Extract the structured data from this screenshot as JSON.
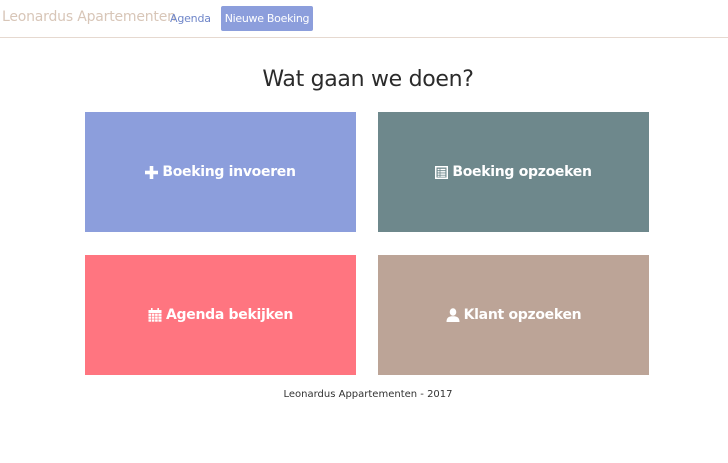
{
  "navbar": {
    "brand": "Leonardus Apartementen",
    "links": [
      {
        "label": "Agenda"
      },
      {
        "label": "Nieuwe Boeking",
        "active": true
      }
    ]
  },
  "main": {
    "title": "Wat gaan we doen?",
    "tiles": [
      {
        "label": "Boeking invoeren",
        "icon": "plus-icon",
        "color": "#8c9edc"
      },
      {
        "label": "Boeking opzoeken",
        "icon": "list-icon",
        "color": "#6e888c"
      },
      {
        "label": "Agenda bekijken",
        "icon": "calendar-icon",
        "color": "#ff7580"
      },
      {
        "label": "Klant opzoeken",
        "icon": "user-icon",
        "color": "#bca497"
      }
    ]
  },
  "footer": {
    "text": "Leonardus Appartementen - 2017"
  }
}
